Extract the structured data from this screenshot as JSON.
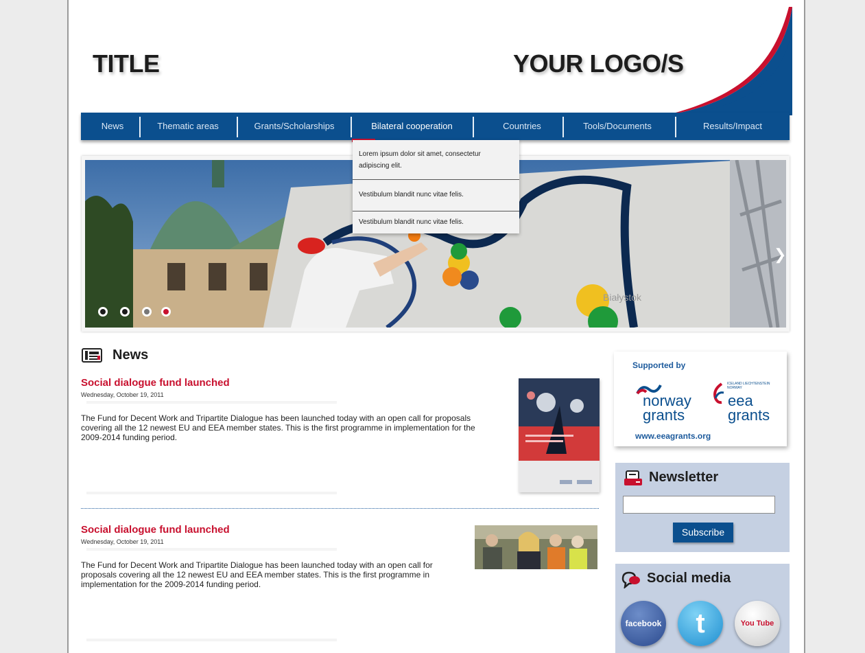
{
  "header": {
    "title": "TITLE",
    "logo_text": "YOUR LOGO/S",
    "colors": {
      "brand_blue": "#0b4f8e",
      "brand_red": "#c8102e"
    }
  },
  "nav": {
    "items": [
      {
        "label": "News"
      },
      {
        "label": "Thematic areas"
      },
      {
        "label": "Grants/Scholarships"
      },
      {
        "label": "Bilateral cooperation",
        "active": true
      },
      {
        "label": "Countries"
      },
      {
        "label": "Tools/Documents"
      },
      {
        "label": "Results/Impact"
      }
    ]
  },
  "dropdown": {
    "items": [
      {
        "label": "Lorem ipsum dolor sit amet, consectetur adipiscing elit."
      },
      {
        "label": "Vestibulum blandit nunc vitae felis."
      },
      {
        "label": "Vestibulum blandit nunc vitae felis."
      }
    ]
  },
  "slider": {
    "dot_count": 4,
    "active_dot": 4,
    "next_icon": "chevron-right-icon",
    "photo_labels": [
      "Białystok"
    ]
  },
  "news": {
    "heading": "News",
    "icon": "newspaper-icon",
    "items": [
      {
        "title": "Social dialogue fund launched",
        "date": "Wednesday, October 19, 2011",
        "body": "The Fund for Decent Work and Tripartite Dialogue has been launched today with an open call for proposals covering all the 12 newest EU and EEA member states. This is the first programme in implementation for the 2009-2014 funding period."
      },
      {
        "title": "Social dialogue fund launched",
        "date": "Wednesday, October 19, 2011",
        "body": "The Fund for Decent Work and Tripartite Dialogue has been launched today with an open call for proposals covering all the 12 newest EU and EEA member states. This is the first programme in implementation for the 2009-2014 funding period."
      }
    ]
  },
  "sidebar": {
    "supported": {
      "heading": "Supported by",
      "norway_line1": "norway",
      "norway_line2": "grants",
      "eea_small": "ICELAND LIECHTENSTEIN NORWAY",
      "eea_line1": "eea",
      "eea_line2": "grants",
      "url": "www.eeagrants.org"
    },
    "newsletter": {
      "heading": "Newsletter",
      "icon": "newsletter-icon",
      "input_value": "",
      "button_label": "Subscribe"
    },
    "social": {
      "heading": "Social media",
      "icon": "speech-bubble-icon",
      "facebook_label": "facebook",
      "twitter_label": "t",
      "youtube_label": "You Tube"
    }
  }
}
